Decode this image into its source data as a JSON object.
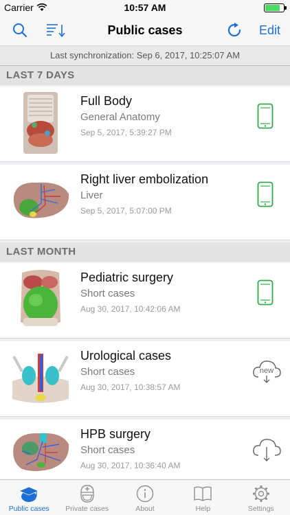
{
  "status_bar": {
    "carrier": "Carrier",
    "time": "10:57 AM"
  },
  "nav": {
    "title": "Public cases",
    "edit_label": "Edit",
    "search_icon": "search-icon",
    "sort_icon": "sort-icon",
    "refresh_icon": "refresh-icon"
  },
  "sync": {
    "text": "Last synchronization: Sep 6, 2017, 10:25:07 AM"
  },
  "sections": [
    {
      "title": "LAST 7 DAYS",
      "rows": [
        {
          "name": "Full Body",
          "category": "General Anatomy",
          "date": "Sep 5, 2017, 5:39:27 PM",
          "status": "on-device"
        },
        {
          "name": "Right liver embolization",
          "category": "Liver",
          "date": "Sep 5, 2017, 5:07:00 PM",
          "status": "on-device"
        }
      ]
    },
    {
      "title": "LAST MONTH",
      "rows": [
        {
          "name": "Pediatric surgery",
          "category": "Short cases",
          "date": "Aug 30, 2017, 10:42:06 AM",
          "status": "on-device"
        },
        {
          "name": "Urological cases",
          "category": "Short cases",
          "date": "Aug 30, 2017, 10:38:57 AM",
          "status": "cloud-new",
          "badge": "new"
        },
        {
          "name": "HPB surgery",
          "category": "Short cases",
          "date": "Aug 30, 2017, 10:36:40 AM",
          "status": "cloud-download"
        }
      ]
    }
  ],
  "tabs": [
    {
      "label": "Public cases",
      "icon": "graduation-cap-icon",
      "active": true
    },
    {
      "label": "Private cases",
      "icon": "surgeon-icon",
      "active": false
    },
    {
      "label": "About",
      "icon": "info-icon",
      "active": false
    },
    {
      "label": "Help",
      "icon": "book-icon",
      "active": false
    },
    {
      "label": "Settings",
      "icon": "gear-icon",
      "active": false
    }
  ],
  "colors": {
    "accent": "#1d6fd6",
    "device_green": "#2eaa4a",
    "cloud_gray": "#6a6a6a"
  }
}
